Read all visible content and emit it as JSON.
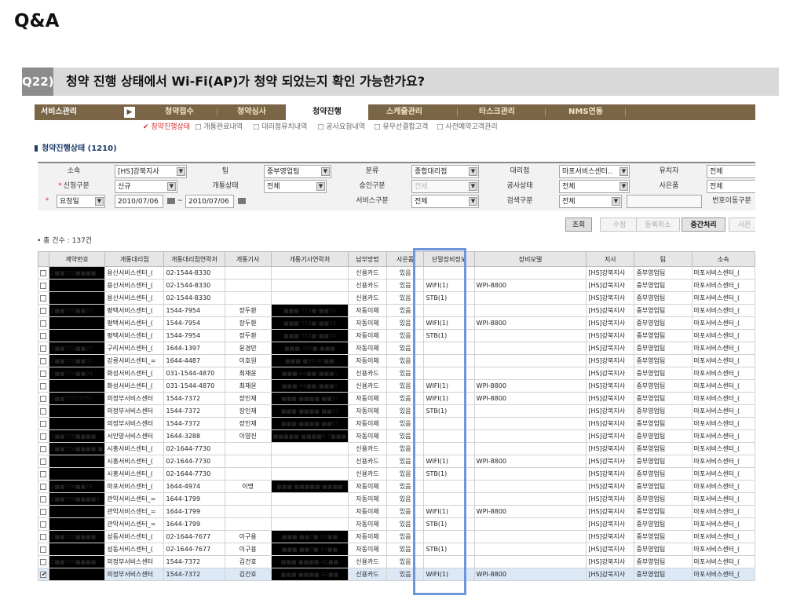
{
  "slide": {
    "title": "Q&A",
    "question_number": "Q22)",
    "question": "청약 진행 상태에서 Wi-Fi(AP)가 청약 되었는지 확인 가능한가요?"
  },
  "menu": {
    "first": "서비스관리",
    "go": "▶",
    "items": [
      "청약접수",
      "청약심사",
      "청약진행",
      "스케줄관리",
      "타스크관리",
      "NMS연동"
    ],
    "active_index": 2
  },
  "submenu": [
    "✔ 청약진행상태",
    "□ 개통완료내역",
    "□ 대리점유치내역",
    "□ 공사요청내역",
    "□ 유무선결합고객",
    "□ 사전예약고객관리"
  ],
  "section_title": "청약진행상태 (1210)",
  "search": {
    "row1": {
      "so_label": "소속",
      "so_value": "[HS]강북지사",
      "team_label": "팀",
      "team_value": "중부영업팀",
      "class_label": "분류",
      "class_value": "종합대리점",
      "agency_label": "대리점",
      "agency_value": "마포서비스센터..",
      "recruiter_label": "유치자",
      "recruiter_value": "전체"
    },
    "row2": {
      "req_label": "신청구분",
      "req_value": "신규",
      "open_label": "개통상태",
      "open_value": "전체",
      "approve_label": "승인구분",
      "approve_value": "전체",
      "work_label": "공사상태",
      "work_value": "전체",
      "gift_label": "사은품",
      "gift_value": "전체"
    },
    "row3": {
      "date_type": "요청일",
      "date_from": "2010/07/06",
      "tilde": "~",
      "date_to": "2010/07/06",
      "service_label": "서비스구분",
      "service_value": "전체",
      "search_label": "검색구분",
      "search_value": "전체",
      "number_label": "번호이동구분"
    }
  },
  "buttons": [
    "조회",
    "수정",
    "등록취소",
    "중간처리",
    "사은"
  ],
  "count_text": "• 총 건수 : 137건",
  "columns": [
    "",
    "계약번호",
    "개통대리점",
    "개통대리점연락처",
    "개통기사",
    "개통기사연락처",
    "납부방법",
    "사은품",
    "단말장비정보",
    "장비모델",
    "지사",
    "팀",
    "소속"
  ],
  "rows": [
    {
      "c": "",
      "no": "2■■773■■■■",
      "ag": "용산서비스센터_(",
      "tel": "02-1544-8330",
      "eng": "",
      "etel": "",
      "pay": "신용카드",
      "gift": "있음",
      "dev": "",
      "model": "",
      "br": "[HS]강북지사",
      "team": "중부영업팀",
      "so": "마포서비스센터_("
    },
    {
      "c": "",
      "no": "",
      "ag": "용산서비스센터_(",
      "tel": "02-1544-8330",
      "eng": "",
      "etel": "",
      "pay": "신용카드",
      "gift": "있음",
      "dev": "WIFI(1)",
      "model": "WPI-8800",
      "br": "[HS]강북지사",
      "team": "중부영업팀",
      "so": "마포서비스센터_("
    },
    {
      "c": "",
      "no": "",
      "ag": "용산서비스센터_(",
      "tel": "02-1544-8330",
      "eng": "",
      "etel": "",
      "pay": "신용카드",
      "gift": "있음",
      "dev": "STB(1)",
      "model": "",
      "br": "[HS]강북지사",
      "team": "중부영업팀",
      "so": "마포서비스센터_("
    },
    {
      "c": "",
      "no": "2■■775■■20",
      "ag": "평택서비스센터_(",
      "tel": "1544-7954",
      "eng": "장두환",
      "etel": "■■■-753■-■■54",
      "pay": "자동이체",
      "gift": "있음",
      "dev": "",
      "model": "",
      "br": "[HS]강북지사",
      "team": "중부영업팀",
      "so": "마포서비스센터_("
    },
    {
      "c": "",
      "no": "",
      "ag": "평택서비스센터_(",
      "tel": "1544-7954",
      "eng": "장두환",
      "etel": "■■■-753■-■■54",
      "pay": "자동이체",
      "gift": "있음",
      "dev": "WIFI(1)",
      "model": "WPI-8800",
      "br": "[HS]강북지사",
      "team": "중부영업팀",
      "so": "마포서비스센터_("
    },
    {
      "c": "",
      "no": "",
      "ag": "평택서비스센터_(",
      "tel": "1544-7954",
      "eng": "장두환",
      "etel": "■■■-753■-■■54",
      "pay": "자동이체",
      "gift": "있음",
      "dev": "STB(1)",
      "model": "",
      "br": "[HS]강북지사",
      "team": "중부영업팀",
      "so": "마포서비스센터_("
    },
    {
      "c": "",
      "no": "2■■773■■27",
      "ag": "구리서비스센터_(",
      "tel": "1644-1397",
      "eng": "윤경만",
      "etel": "■■■-450■-■■■",
      "pay": "자동이체",
      "gift": "있음",
      "dev": "",
      "model": "",
      "br": "[HS]강북지사",
      "team": "중부영업팀",
      "so": "마포서비스센터_("
    },
    {
      "c": "",
      "no": "2■■773■■32",
      "ag": "강릉서비스센터_=",
      "tel": "1644-4487",
      "eng": "이호원",
      "etel": "■■■-■95-40■■",
      "pay": "자동이체",
      "gift": "있음",
      "dev": "",
      "model": "",
      "br": "[HS]강북지사",
      "team": "중부영업팀",
      "so": "마포서비스센터_("
    },
    {
      "c": "",
      "no": "2■■774■■24",
      "ag": "화성서비스센터_(",
      "tel": "031-1544-4870",
      "eng": "최재윤",
      "etel": "■■■-44■■-■■■1",
      "pay": "신용카드",
      "gift": "있음",
      "dev": "",
      "model": "",
      "br": "[HS]강북지사",
      "team": "중부영업팀",
      "so": "마포서비스센터_("
    },
    {
      "c": "",
      "no": "",
      "ag": "화성서비스센터_(",
      "tel": "031-1544-4870",
      "eng": "최재윤",
      "etel": "■■■-44■■-■■■1",
      "pay": "신용카드",
      "gift": "있음",
      "dev": "WIFI(1)",
      "model": "WPI-8800",
      "br": "[HS]강북지사",
      "team": "중부영업팀",
      "so": "마포서비스센터_("
    },
    {
      "c": "",
      "no": "2■■7757375?",
      "ag": "의정부서비스센터",
      "tel": "1544-7372",
      "eng": "장인재",
      "etel": "■■■-■■■■-■■5?",
      "pay": "자동이체",
      "gift": "있음",
      "dev": "WIFI(1)",
      "model": "WPI-8800",
      "br": "[HS]강북지사",
      "team": "중부영업팀",
      "so": "마포서비스센터_("
    },
    {
      "c": "",
      "no": "",
      "ag": "의정부서비스센터",
      "tel": "1544-7372",
      "eng": "장인재",
      "etel": "■■■-■■■■-■■5?",
      "pay": "자동이체",
      "gift": "있음",
      "dev": "STB(1)",
      "model": "",
      "br": "[HS]강북지사",
      "team": "중부영업팀",
      "so": "마포서비스센터_("
    },
    {
      "c": "",
      "no": "",
      "ag": "의정부서비스센터",
      "tel": "1544-7372",
      "eng": "장인재",
      "etel": "■■■-■■■■-■■5?",
      "pay": "자동이체",
      "gift": "있음",
      "dev": "",
      "model": "",
      "br": "[HS]강북지사",
      "team": "중부영업팀",
      "so": "마포서비스센터_("
    },
    {
      "c": "",
      "no": "2■■775■■■■",
      "ag": "서안양서비스센터",
      "tel": "1644-3288",
      "eng": "이영진",
      "etel": "■■■■■-■■■■5-7■■■",
      "pay": "자동이체",
      "gift": "있음",
      "dev": "",
      "model": "",
      "br": "[HS]강북지사",
      "team": "중부영업팀",
      "so": "마포서비스센터_("
    },
    {
      "c": "",
      "no": "2■■774■■■■ ■",
      "ag": "시흥서비스센터_(",
      "tel": "02-1644-7730",
      "eng": "",
      "etel": "",
      "pay": "신용카드",
      "gift": "있음",
      "dev": "",
      "model": "",
      "br": "[HS]강북지사",
      "team": "중부영업팀",
      "so": "마포서비스센터_("
    },
    {
      "c": "",
      "no": "",
      "ag": "시흥서비스센터_(",
      "tel": "02-1644-7730",
      "eng": "",
      "etel": "",
      "pay": "신용카드",
      "gift": "있음",
      "dev": "WIFI(1)",
      "model": "WPI-8800",
      "br": "[HS]강북지사",
      "team": "중부영업팀",
      "so": "마포서비스센터_("
    },
    {
      "c": "",
      "no": "",
      "ag": "시흥서비스센터_(",
      "tel": "02-1644-7730",
      "eng": "",
      "etel": "",
      "pay": "신용카드",
      "gift": "있음",
      "dev": "STB(1)",
      "model": "",
      "br": "[HS]강북지사",
      "team": "중부영업팀",
      "so": "마포서비스센터_("
    },
    {
      "c": "",
      "no": "2■■774■■76",
      "ag": "마포서비스센터_(",
      "tel": "1644-4974",
      "eng": "이명",
      "etel": "■■■-■■■■■-■■■■",
      "pay": "자동이체",
      "gift": "있음",
      "dev": "",
      "model": "",
      "br": "[HS]강북지사",
      "team": "중부영업팀",
      "so": "마포서비스센터_("
    },
    {
      "c": "",
      "no": "2■■774■■■■9",
      "ag": "관악서비스센터_=",
      "tel": "1644-1799",
      "eng": "",
      "etel": "",
      "pay": "자동이체",
      "gift": "있음",
      "dev": "",
      "model": "",
      "br": "[HS]강북지사",
      "team": "중부영업팀",
      "so": "마포서비스센터_("
    },
    {
      "c": "",
      "no": "",
      "ag": "관악서비스센터_=",
      "tel": "1644-1799",
      "eng": "",
      "etel": "",
      "pay": "자동이체",
      "gift": "있음",
      "dev": "WIFI(1)",
      "model": "WPI-8800",
      "br": "[HS]강북지사",
      "team": "중부영업팀",
      "so": "마포서비스센터_("
    },
    {
      "c": "",
      "no": "",
      "ag": "관악서비스센터_=",
      "tel": "1644-1799",
      "eng": "",
      "etel": "",
      "pay": "자동이체",
      "gift": "있음",
      "dev": "STB(1)",
      "model": "",
      "br": "[HS]강북지사",
      "team": "중부영업팀",
      "so": "마포서비스센터_("
    },
    {
      "c": "",
      "no": "2■■775■■■■",
      "ag": "성동서비스센터_(",
      "tel": "02-1644-7677",
      "eng": "이구용",
      "etel": "■■■-■■7■-47■■",
      "pay": "자동이체",
      "gift": "있음",
      "dev": "",
      "model": "",
      "br": "[HS]강북지사",
      "team": "중부영업팀",
      "so": "마포서비스센터_("
    },
    {
      "c": "",
      "no": "",
      "ag": "성동서비스센터_(",
      "tel": "02-1644-7677",
      "eng": "이구용",
      "etel": "■■■-■■7■-47■■",
      "pay": "자동이체",
      "gift": "있음",
      "dev": "STB(1)",
      "model": "",
      "br": "[HS]강북지사",
      "team": "중부영업팀",
      "so": "마포서비스센터_("
    },
    {
      "c": "",
      "no": "2■■775■■■■",
      "ag": "의정부서비스센터",
      "tel": "1544-7372",
      "eng": "김건호",
      "etel": "■■■-■■■■-42■■",
      "pay": "신용카드",
      "gift": "있음",
      "dev": "",
      "model": "",
      "br": "[HS]강북지사",
      "team": "중부영업팀",
      "so": "마포서비스센터_("
    },
    {
      "c": "✔",
      "no": "",
      "ag": "의정부서비스센터",
      "tel": "1544-7372",
      "eng": "김건호",
      "etel": "■■■-■■■■-42■■",
      "pay": "신용카드",
      "gift": "있음",
      "dev": "WIFI(1)",
      "model": "WPI-8800",
      "br": "[HS]강북지사",
      "team": "중부영업팀",
      "so": "마포서비스센터_("
    }
  ]
}
